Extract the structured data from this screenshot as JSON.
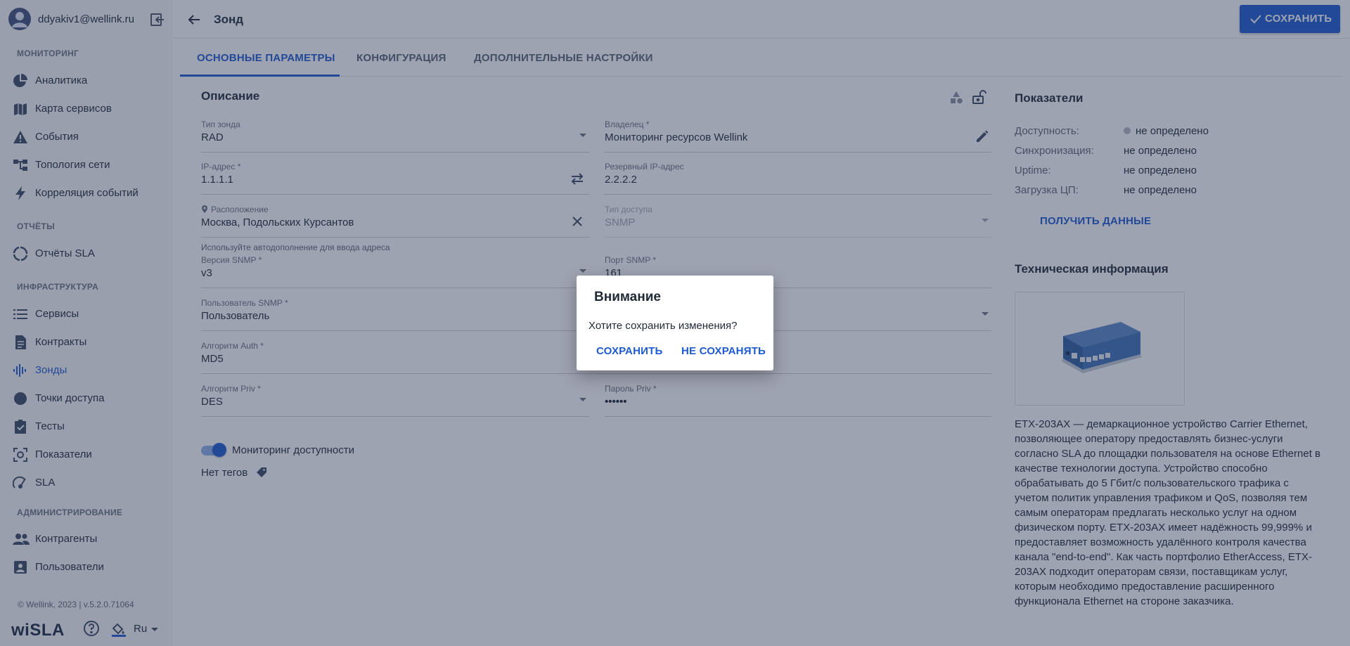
{
  "user": {
    "email": "ddyakiv1@wellink.ru"
  },
  "sidebar": {
    "sections": [
      {
        "title": "МОНИТОРИНГ",
        "items": [
          "Аналитика",
          "Карта сервисов",
          "События",
          "Топология сети",
          "Корреляция событий"
        ]
      },
      {
        "title": "ОТЧЁТЫ",
        "items": [
          "Отчёты SLA"
        ]
      },
      {
        "title": "ИНФРАСТРУКТУРА",
        "items": [
          "Сервисы",
          "Контракты",
          "Зонды",
          "Точки доступа",
          "Тесты",
          "Показатели",
          "SLA"
        ]
      },
      {
        "title": "АДМИНИСТРИРОВАНИЕ",
        "items": [
          "Контрагенты",
          "Пользователи"
        ]
      }
    ],
    "footer": "© Wellink, 2023 | v.5.2.0.71064",
    "logo": "wiSLA",
    "language": "Ru"
  },
  "header": {
    "title": "Зонд",
    "save_label": "СОХРАНИТЬ"
  },
  "tabs": [
    "ОСНОВНЫЕ ПАРАМЕТРЫ",
    "КОНФИГУРАЦИЯ",
    "ДОПОЛНИТЕЛЬНЫЕ НАСТРОЙКИ"
  ],
  "form": {
    "title": "Описание",
    "probe_type": {
      "label": "Тип зонда",
      "value": "RAD"
    },
    "owner": {
      "label": "Владелец *",
      "value": "Мониторинг ресурсов Wellink"
    },
    "ip": {
      "label": "IP-адрес *",
      "value": "1.1.1.1"
    },
    "backup_ip": {
      "label": "Резервный IP-адрес",
      "value": "2.2.2.2"
    },
    "location": {
      "label": "Расположение",
      "value": "Москва, Подольских Курсантов"
    },
    "access_type": {
      "label": "Тип доступа",
      "value": "SNMP"
    },
    "location_hint": "Используйте автодополнение для ввода адреса",
    "snmp_version": {
      "label": "Версия SNMP *",
      "value": "v3"
    },
    "snmp_port": {
      "label": "Порт SNMP *",
      "value": "161"
    },
    "snmp_user": {
      "label": "Пользователь SNMP *",
      "value": "Пользователь"
    },
    "auth_algo": {
      "label": "Алгоритм Auth *",
      "value": "MD5"
    },
    "priv_algo": {
      "label": "Алгоритм Priv *",
      "value": "DES"
    },
    "priv_password": {
      "label": "Пароль Priv *",
      "value": "••••••"
    },
    "monitoring_label": "Мониторинг доступности",
    "tags_label": "Нет тегов"
  },
  "metrics": {
    "title": "Показатели",
    "rows": [
      {
        "label": "Доступность:",
        "value": "не определено"
      },
      {
        "label": "Синхронизация:",
        "value": "не определено"
      },
      {
        "label": "Uptime:",
        "value": "не определено"
      },
      {
        "label": "Загрузка ЦП:",
        "value": "не определено"
      }
    ],
    "get_data_label": "ПОЛУЧИТЬ ДАННЫЕ"
  },
  "tech": {
    "title": "Техническая информация",
    "description": "ETX-203AX — демаркационное устройство Carrier Ethernet, позволяющее оператору предоставлять бизнес-услуги согласно SLA до площадки пользователя на основе Ethernet в качестве технологии доступа. Устройство способно обрабатывать до 5 Гбит/с пользовательского трафика с учетом политик управления трафиком и QoS, позволяя тем самым операторам предлагать несколько услуг на одном физическом порту. ETX-203AX имеет надёжность 99,999% и предоставляет возможность удалённого контроля качества канала \"end-to-end\". Как часть портфолио EtherAccess, ETX-203AX подходит операторам связи, поставщикам услуг, которым необходимо предоставление расширенного функционала Ethernet на стороне заказчика."
  },
  "dialog": {
    "title": "Внимание",
    "message": "Хотите сохранить изменения?",
    "save_label": "СОХРАНИТЬ",
    "dont_save_label": "НЕ СОХРАНЯТЬ"
  },
  "colors": {
    "accent": "#1e5bd0",
    "sidebar_bg": "#f7f8fa",
    "overlay": "#283452"
  }
}
